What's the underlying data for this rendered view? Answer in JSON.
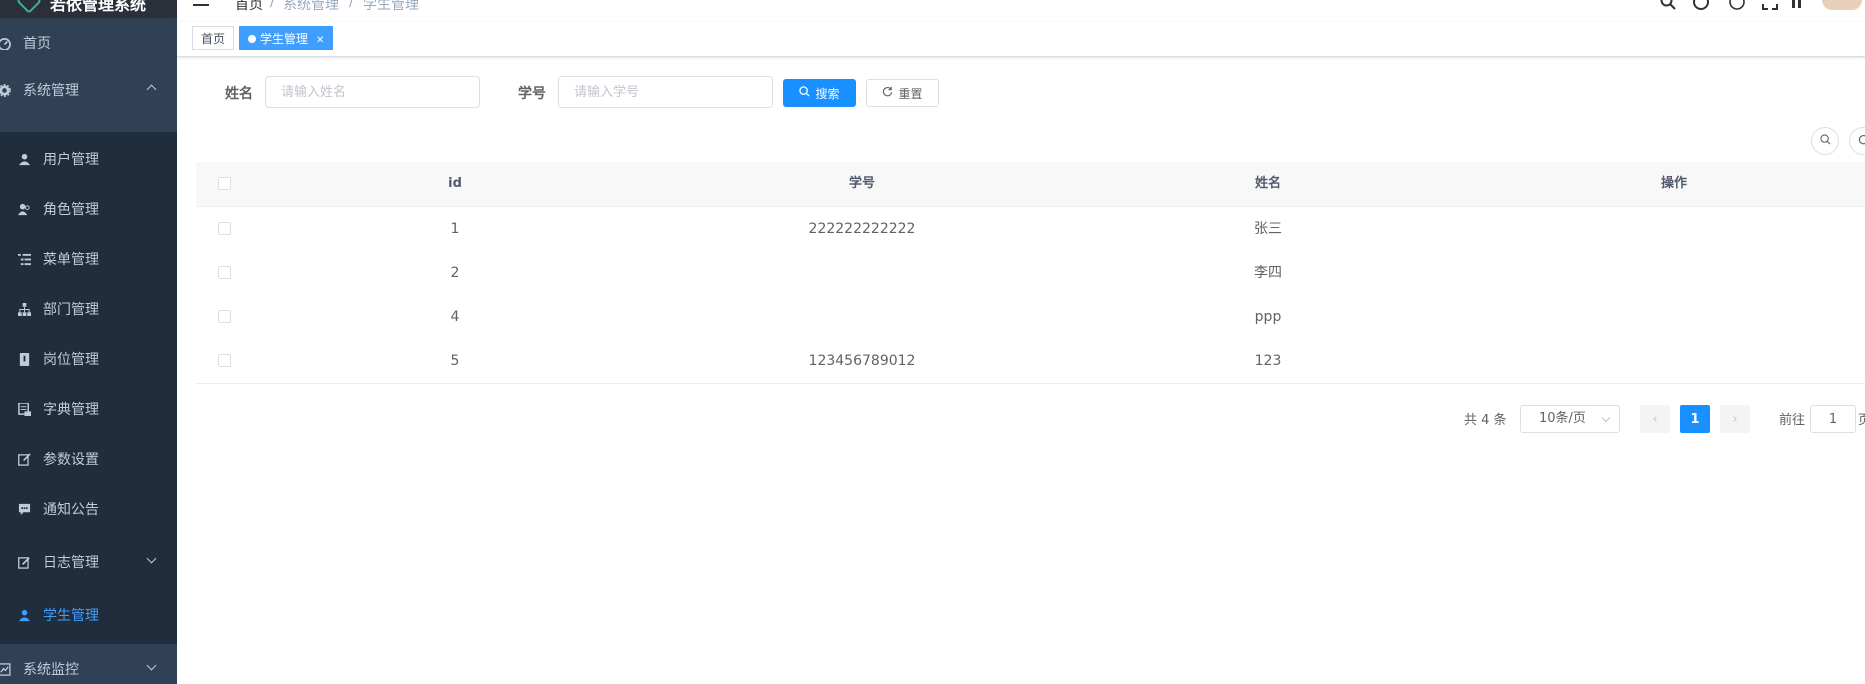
{
  "app": {
    "title": "若依管理系统"
  },
  "sidebar": {
    "items": [
      {
        "label": "首页",
        "icon": "dashboard-icon"
      },
      {
        "label": "系统管理",
        "icon": "gear-icon",
        "expanded": true
      },
      {
        "label": "用户管理",
        "icon": "user-icon"
      },
      {
        "label": "角色管理",
        "icon": "peoples-icon"
      },
      {
        "label": "菜单管理",
        "icon": "tree-table-icon"
      },
      {
        "label": "部门管理",
        "icon": "tree-icon"
      },
      {
        "label": "岗位管理",
        "icon": "post-icon"
      },
      {
        "label": "字典管理",
        "icon": "dict-icon"
      },
      {
        "label": "参数设置",
        "icon": "edit-icon"
      },
      {
        "label": "通知公告",
        "icon": "message-icon"
      },
      {
        "label": "日志管理",
        "icon": "log-icon"
      },
      {
        "label": "学生管理",
        "icon": "user-icon",
        "active": true
      },
      {
        "label": "系统监控",
        "icon": "monitor-icon"
      }
    ]
  },
  "breadcrumb": [
    "首页",
    "系统管理",
    "学生管理"
  ],
  "tags": [
    {
      "label": "首页"
    },
    {
      "label": "学生管理",
      "active": true
    }
  ],
  "search": {
    "name_label": "姓名",
    "name_placeholder": "请输入姓名",
    "name_value": "",
    "no_label": "学号",
    "no_placeholder": "请输入学号",
    "no_value": "",
    "search_label": "搜索",
    "reset_label": "重置"
  },
  "table": {
    "columns": [
      "id",
      "学号",
      "姓名",
      "操作"
    ],
    "rows": [
      {
        "id": "1",
        "no": "222222222222",
        "name": "张三"
      },
      {
        "id": "2",
        "no": "",
        "name": "李四"
      },
      {
        "id": "4",
        "no": "",
        "name": "ppp"
      },
      {
        "id": "5",
        "no": "123456789012",
        "name": "123"
      }
    ]
  },
  "pagination": {
    "total_text": "共 4 条",
    "page_size": "10条/页",
    "current_page": "1",
    "jump_label": "前往",
    "jump_value": "1",
    "jump_suffix": "页"
  },
  "colors": {
    "sidebar_bg": "#304156",
    "submenu_bg": "#1f2d3d",
    "accent": "#1890ff",
    "active_text": "#409eff"
  }
}
